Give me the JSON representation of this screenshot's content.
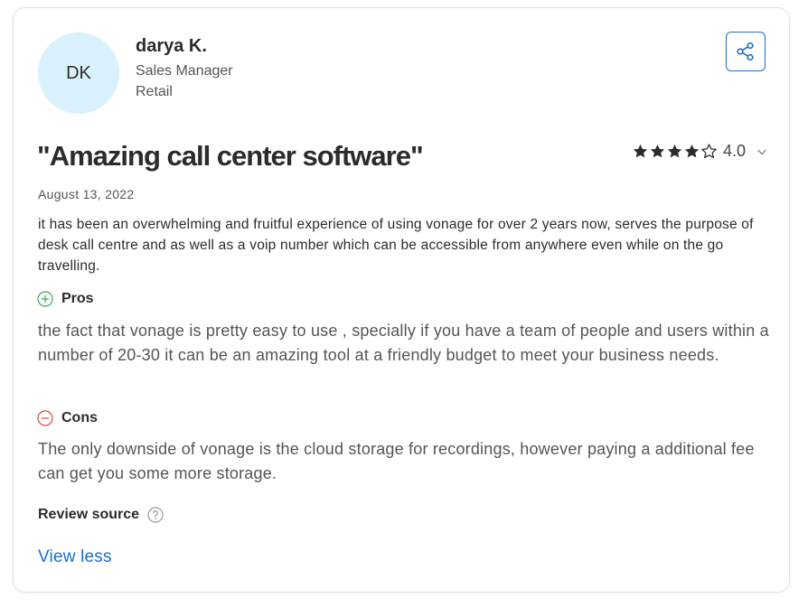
{
  "reviewer": {
    "initials": "DK",
    "name": "darya K.",
    "role": "Sales Manager",
    "industry": "Retail",
    "avatar_color": "#d9f1fb"
  },
  "actions": {
    "share_icon": "share-icon",
    "accent_color": "#1a6dc7"
  },
  "review": {
    "title": "\"Amazing call center software\"",
    "rating": 4,
    "rating_max": 5,
    "rating_label": "4.0",
    "date": "August 13, 2022",
    "summary": "it has been an overwhelming and fruitful experience of using vonage for over 2 years now, serves the purpose of desk call centre and as well as a voip number which can be accessible from anywhere even while on the go travelling.",
    "pros_label": "Pros",
    "pros_text": "the fact that vonage is pretty easy to use , specially if you have a team of people and users within a number of 20-30 it can be an amazing tool at a friendly budget to meet your business needs.",
    "cons_label": "Cons",
    "cons_text": "The only downside of vonage is the cloud storage for recordings, however paying a additional fee can get you some more storage.",
    "pros_color": "#3aa757",
    "cons_color": "#e0463b"
  },
  "footer": {
    "review_source_label": "Review source",
    "view_less_label": "View less"
  }
}
